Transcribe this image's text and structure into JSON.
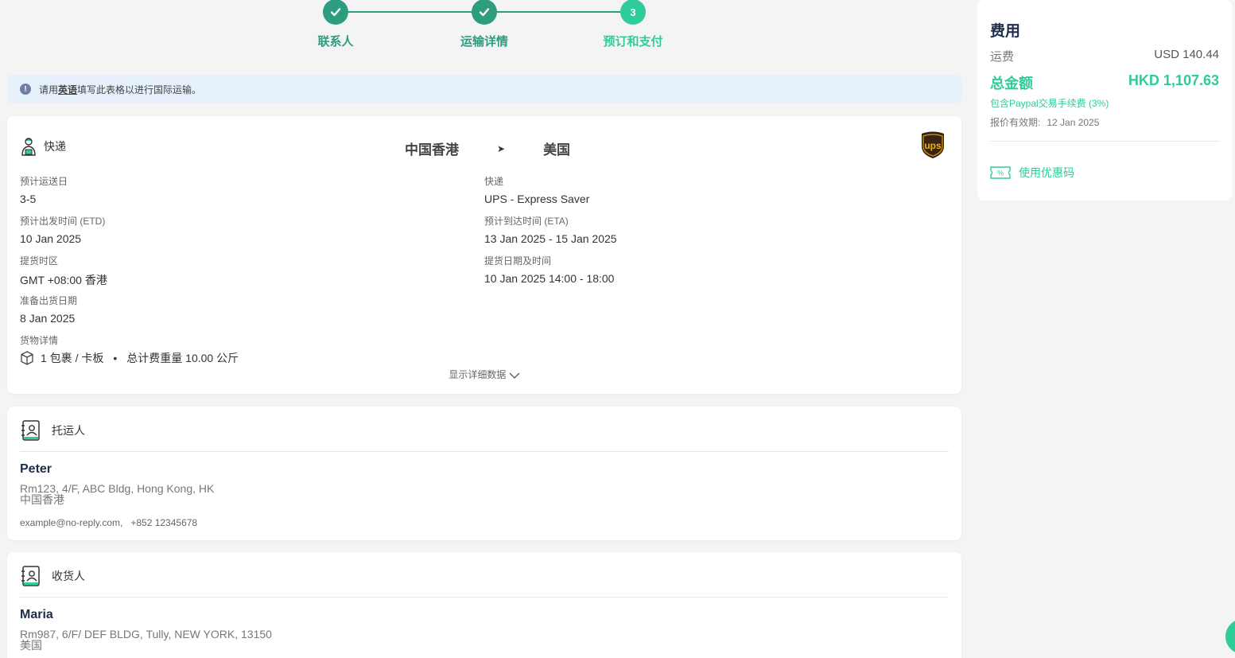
{
  "stepper": {
    "steps": [
      {
        "label": "联系人",
        "state": "done"
      },
      {
        "label": "运输详情",
        "state": "done"
      },
      {
        "label": "预订和支付",
        "state": "active",
        "number": "3"
      }
    ]
  },
  "notice": {
    "prefix": "请用",
    "emphasis": "英语",
    "suffix": "填写此表格以进行国际运输。"
  },
  "shipment": {
    "type_label": "快递",
    "origin": "中国香港",
    "destination": "美国",
    "carrier_logo": "ups-logo",
    "fields_left": [
      {
        "label": "预计运送日",
        "value": "3-5"
      },
      {
        "label": "预计出发时间 (ETD)",
        "value": "10 Jan 2025"
      },
      {
        "label": "提货时区",
        "value": "GMT +08:00 香港"
      },
      {
        "label": "准备出货日期",
        "value": "8 Jan 2025"
      }
    ],
    "fields_right": [
      {
        "label": "快递",
        "value": "UPS - Express Saver"
      },
      {
        "label": "预计到达时间 (ETA)",
        "value": "13 Jan 2025 - 15 Jan 2025"
      },
      {
        "label": "提货日期及时间",
        "value": "10 Jan 2025 14:00 - 18:00"
      }
    ],
    "cargo_label": "货物详情",
    "cargo_packages": "1 包裹 / 卡板",
    "cargo_weight": "总计费重量 10.00 公斤",
    "show_more": "显示详细数据"
  },
  "shipper": {
    "title": "托运人",
    "name": "Peter",
    "address_line1": "Rm123, 4/F, ABC Bldg, Hong Kong, HK",
    "address_line2": "中国香港",
    "contact": "example@no-reply.com,   +852 12345678"
  },
  "consignee": {
    "title": "收货人",
    "name": "Maria",
    "address_line1": "Rm987, 6/F/ DEF BLDG, Tully, NEW YORK, 13150",
    "address_line2": "美国"
  },
  "fees": {
    "title": "费用",
    "freight_label": "运费",
    "freight_value": "USD 140.44",
    "total_label": "总金额",
    "total_value": "HKD 1,107.63",
    "paypal_note": "包含Paypal交易手续费 (3%)",
    "validity_label": "报价有效期:",
    "validity_value": "12 Jan 2025",
    "coupon_label": "使用优惠码"
  },
  "colors": {
    "primary": "#2e9c7e",
    "accent": "#2ecc9a",
    "notice_bg": "#e6f1fb",
    "name_text": "#1f2d4a"
  }
}
